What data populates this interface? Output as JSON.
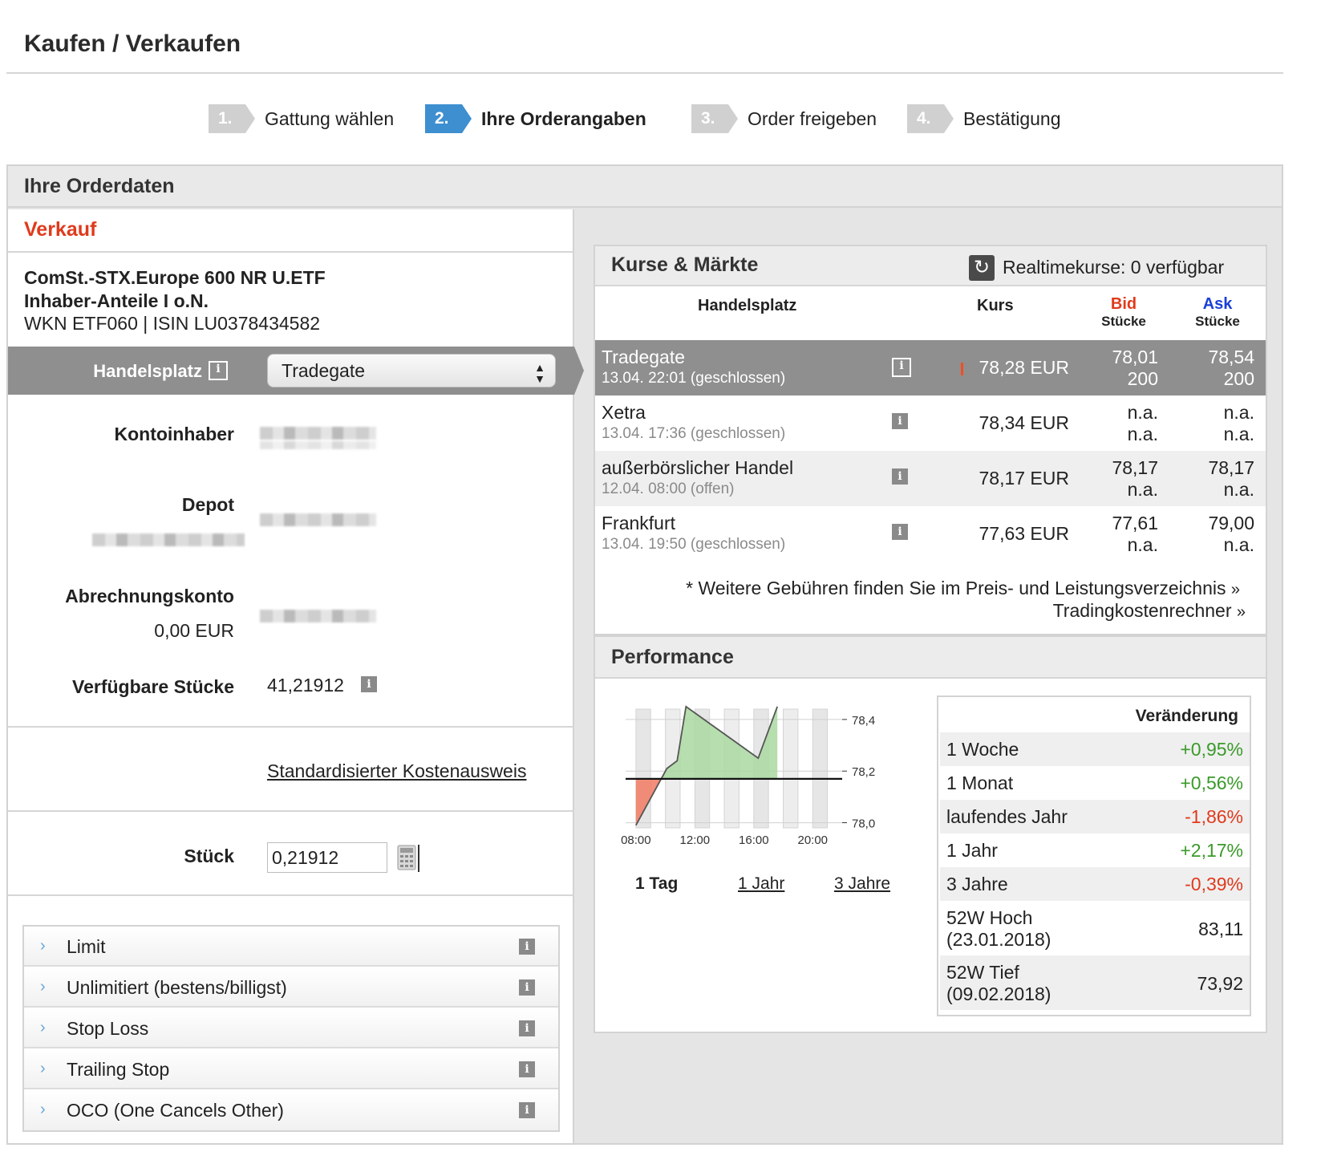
{
  "page": {
    "title": "Kaufen / Verkaufen"
  },
  "steps": [
    {
      "num": "1.",
      "label": "Gattung wählen",
      "active": false
    },
    {
      "num": "2.",
      "label": "Ihre Orderangaben",
      "active": true
    },
    {
      "num": "3.",
      "label": "Order freigeben",
      "active": false
    },
    {
      "num": "4.",
      "label": "Bestätigung",
      "active": false
    }
  ],
  "orderdata": {
    "header": "Ihre Orderdaten",
    "side": "Verkauf",
    "security_name_line1": "ComSt.-STX.Europe 600 NR U.ETF",
    "security_name_line2": "Inhaber-Anteile I o.N.",
    "security_ids": "WKN ETF060 | ISIN LU0378434582",
    "handelsplatz_label": "Handelsplatz",
    "handelsplatz_value": "Tradegate",
    "kontoinhaber_label": "Kontoinhaber",
    "depot_label": "Depot",
    "abrechnungskonto_label": "Abrechnungskonto",
    "abrechnungskonto_balance": "0,00 EUR",
    "verfuegbare_label": "Verfügbare Stücke",
    "verfuegbare_value": "41,21912",
    "kosten_link": "Standardisierter Kostenausweis",
    "stueck_label": "Stück",
    "stueck_value": "0,21912"
  },
  "ordertypes": [
    {
      "label": "Limit"
    },
    {
      "label": "Unlimitiert (bestens/billigst)"
    },
    {
      "label": "Stop Loss"
    },
    {
      "label": "Trailing Stop"
    },
    {
      "label": "OCO (One Cancels Other)"
    }
  ],
  "markets": {
    "title": "Kurse & Märkte",
    "realtime": "Realtimekurse: 0 verfügbar",
    "col_handelsplatz": "Handelsplatz",
    "col_kurs": "Kurs",
    "col_bid": "Bid",
    "col_ask": "Ask",
    "col_stueck": "Stücke",
    "bid_color": "#e03a1c",
    "ask_color": "#1a3fd6",
    "rows": [
      {
        "name": "Tradegate",
        "sub": "13.04. 22:01 (geschlossen)",
        "kurs": "78,28 EUR",
        "bid": "78,01",
        "bid_qty": "200",
        "ask": "78,54",
        "ask_qty": "200"
      },
      {
        "name": "Xetra",
        "sub": "13.04. 17:36 (geschlossen)",
        "kurs": "78,34 EUR",
        "bid": "n.a.",
        "bid_qty": "n.a.",
        "ask": "n.a.",
        "ask_qty": "n.a."
      },
      {
        "name": "außerbörslicher Handel",
        "sub": "12.04. 08:00 (offen)",
        "kurs": "78,17 EUR",
        "bid": "78,17",
        "bid_qty": "n.a.",
        "ask": "78,17",
        "ask_qty": "n.a."
      },
      {
        "name": "Frankfurt",
        "sub": "13.04. 19:50 (geschlossen)",
        "kurs": "77,63 EUR",
        "bid": "77,61",
        "bid_qty": "n.a.",
        "ask": "79,00",
        "ask_qty": "n.a."
      }
    ],
    "fee_note": "* Weitere Gebühren finden Sie im Preis- und Leistungsverzeichnis",
    "calc_link": "Tradingkostenrechner"
  },
  "performance": {
    "title": "Performance",
    "tabs": [
      {
        "label": "1 Tag",
        "active": true
      },
      {
        "label": "1 Jahr",
        "active": false
      },
      {
        "label": "3 Jahre",
        "active": false
      }
    ],
    "change_header": "Veränderung",
    "rows": [
      {
        "label": "1 Woche",
        "value": "+0,95%",
        "sign": "pos"
      },
      {
        "label": "1 Monat",
        "value": "+0,56%",
        "sign": "pos"
      },
      {
        "label": "laufendes Jahr",
        "value": "-1,86%",
        "sign": "neg"
      },
      {
        "label": "1 Jahr",
        "value": "+2,17%",
        "sign": "pos"
      },
      {
        "label": "3 Jahre",
        "value": "-0,39%",
        "sign": "neg"
      },
      {
        "label": "52W Hoch",
        "label2": "(23.01.2018)",
        "value": "83,11",
        "sign": "neu"
      },
      {
        "label": "52W Tief",
        "label2": "(09.02.2018)",
        "value": "73,92",
        "sign": "neu"
      }
    ]
  },
  "chart_data": {
    "type": "area",
    "x_ticks": [
      "08:00",
      "12:00",
      "16:00",
      "20:00"
    ],
    "y_ticks": [
      "78,4",
      "78,2",
      "78,0"
    ],
    "ylim": [
      77.98,
      78.44
    ],
    "baseline": 78.17,
    "x": [
      8.0,
      10.1,
      10.8,
      11.4,
      16.3,
      17.6
    ],
    "y": [
      77.99,
      78.21,
      78.24,
      78.45,
      78.25,
      78.45
    ],
    "up_color": "#a9d8a0",
    "down_color": "#f07a63"
  }
}
